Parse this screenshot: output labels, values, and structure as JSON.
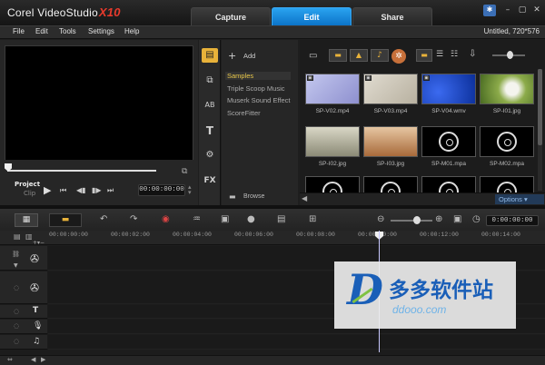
{
  "app": {
    "brand_name": "Corel VideoStudio",
    "brand_version": "X10",
    "project_info": "Untitled, 720*576"
  },
  "mode_tabs": [
    {
      "label": "Capture",
      "active": false
    },
    {
      "label": "Edit",
      "active": true
    },
    {
      "label": "Share",
      "active": false
    }
  ],
  "menu": [
    "File",
    "Edit",
    "Tools",
    "Settings",
    "Help"
  ],
  "player": {
    "mode_project": "Project",
    "mode_clip": "Clip",
    "timecode": "00:00:00:00"
  },
  "library": {
    "add_label": "Add",
    "browse_label": "Browse",
    "options_label": "Options",
    "fx_label": "FX",
    "folders": [
      {
        "label": "Samples",
        "selected": true
      },
      {
        "label": "Triple Scoop Music",
        "selected": false
      },
      {
        "label": "Muserk Sound Effect",
        "selected": false
      },
      {
        "label": "ScoreFitter",
        "selected": false
      }
    ],
    "items": [
      {
        "name": "SP-V02.mp4",
        "kind": "video",
        "color": "#9aa0d6"
      },
      {
        "name": "SP-V03.mp4",
        "kind": "video",
        "color": "#c9c3b6"
      },
      {
        "name": "SP-V04.wmv",
        "kind": "video",
        "color": "#1e49c8"
      },
      {
        "name": "SP-I01.jpg",
        "kind": "image",
        "color": "#6f8f3a"
      },
      {
        "name": "SP-I02.jpg",
        "kind": "image",
        "color": "#c8c7b6"
      },
      {
        "name": "SP-I03.jpg",
        "kind": "image",
        "color": "#c89a6e"
      },
      {
        "name": "SP-M01.mpa",
        "kind": "audio"
      },
      {
        "name": "SP-M02.mpa",
        "kind": "audio"
      }
    ]
  },
  "timeline": {
    "timecode": "0:00:00:00",
    "ruler": [
      "00:00:00:00",
      "00:00:02:00",
      "00:00:04:00",
      "00:00:06:00",
      "00:00:08:00",
      "00:00:10:00",
      "00:00:12:00",
      "00:00:14:00"
    ]
  },
  "watermark": {
    "logo_letter": "D",
    "title": "多多软件站",
    "url": "ddooo.com"
  },
  "colors": {
    "accent": "#1a8fe0",
    "folder_selected": "#e9c84a",
    "brand_red": "#e83a2c"
  }
}
